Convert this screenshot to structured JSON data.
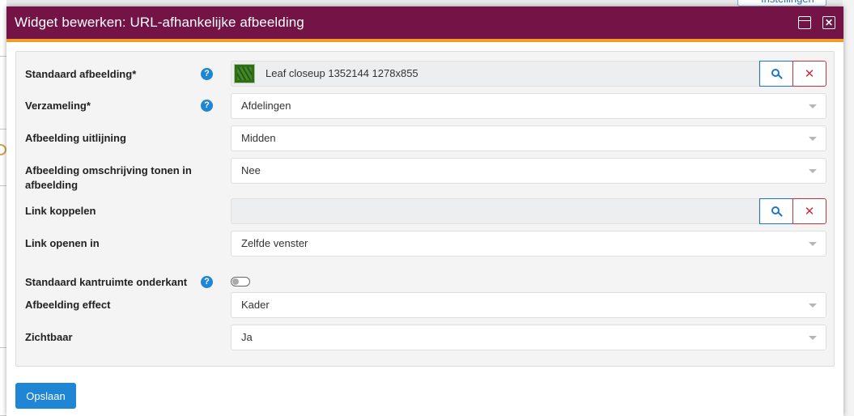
{
  "background": {
    "settings_label": "Instellingen"
  },
  "dialog": {
    "title": "Widget bewerken: URL-afhankelijke afbeelding",
    "maximize_icon": "maximize-icon",
    "close_icon": "close-icon"
  },
  "form": {
    "standard_image": {
      "label": "Standaard afbeelding*",
      "value": "Leaf closeup 1352144 1278x855",
      "has_help": true
    },
    "collection": {
      "label": "Verzameling*",
      "value": "Afdelingen",
      "has_help": true
    },
    "alignment": {
      "label": "Afbeelding uitlijning",
      "value": "Midden"
    },
    "show_description": {
      "label": "Afbeelding omschrijving tonen in afbeelding",
      "value": "Nee"
    },
    "link": {
      "label": "Link koppelen",
      "value": ""
    },
    "link_open": {
      "label": "Link openen in",
      "value": "Zelfde venster"
    },
    "margin_bottom": {
      "label": "Standaard kantruimte onderkant",
      "has_help": true,
      "enabled": false
    },
    "effect": {
      "label": "Afbeelding effect",
      "value": "Kader"
    },
    "visible": {
      "label": "Zichtbaar",
      "value": "Ja"
    },
    "help_glyph": "?",
    "clear_glyph": "✕"
  },
  "footer": {
    "save_label": "Opslaan"
  },
  "colors": {
    "header_bg": "#731346",
    "header_accent": "#f39c2a",
    "primary": "#1f86d6",
    "danger": "#c9303e"
  }
}
